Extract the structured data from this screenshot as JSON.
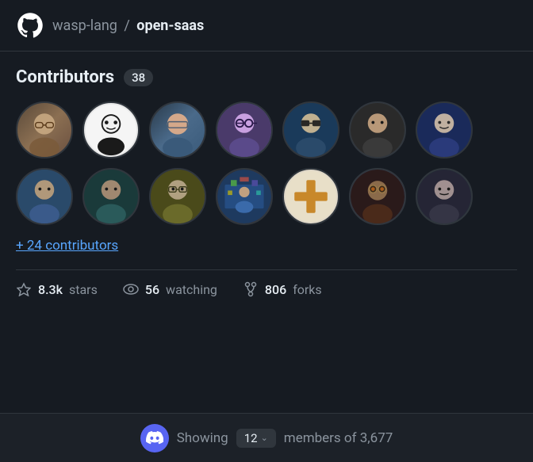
{
  "header": {
    "org": "wasp-lang",
    "slash": "/",
    "repo": "open-saas",
    "logo_alt": "GitHub logo"
  },
  "contributors": {
    "title": "Contributors",
    "count": "38",
    "avatars_row1": [
      {
        "id": 1,
        "cls": "av1"
      },
      {
        "id": 2,
        "cls": "av-bw"
      },
      {
        "id": 3,
        "cls": "av3"
      },
      {
        "id": 4,
        "cls": "av4"
      },
      {
        "id": 5,
        "cls": "av5"
      },
      {
        "id": 6,
        "cls": "av6"
      },
      {
        "id": 7,
        "cls": "av7"
      }
    ],
    "avatars_row2": [
      {
        "id": 8,
        "cls": "av8"
      },
      {
        "id": 9,
        "cls": "av9"
      },
      {
        "id": 10,
        "cls": "av10"
      },
      {
        "id": 11,
        "cls": "av11"
      },
      {
        "id": 12,
        "cls": "av-cross"
      },
      {
        "id": 13,
        "cls": "av12"
      },
      {
        "id": 14,
        "cls": "av9"
      }
    ],
    "more_label": "+ 24 contributors"
  },
  "stats": [
    {
      "icon": "star-icon",
      "value": "8.3k",
      "label": "stars"
    },
    {
      "icon": "eye-icon",
      "value": "56",
      "label": "watching"
    },
    {
      "icon": "fork-icon",
      "value": "806",
      "label": "forks"
    }
  ],
  "bottom_bar": {
    "showing_label": "Showing",
    "count_value": "12",
    "chevron": "∨",
    "members_label": "members of 3,677"
  }
}
